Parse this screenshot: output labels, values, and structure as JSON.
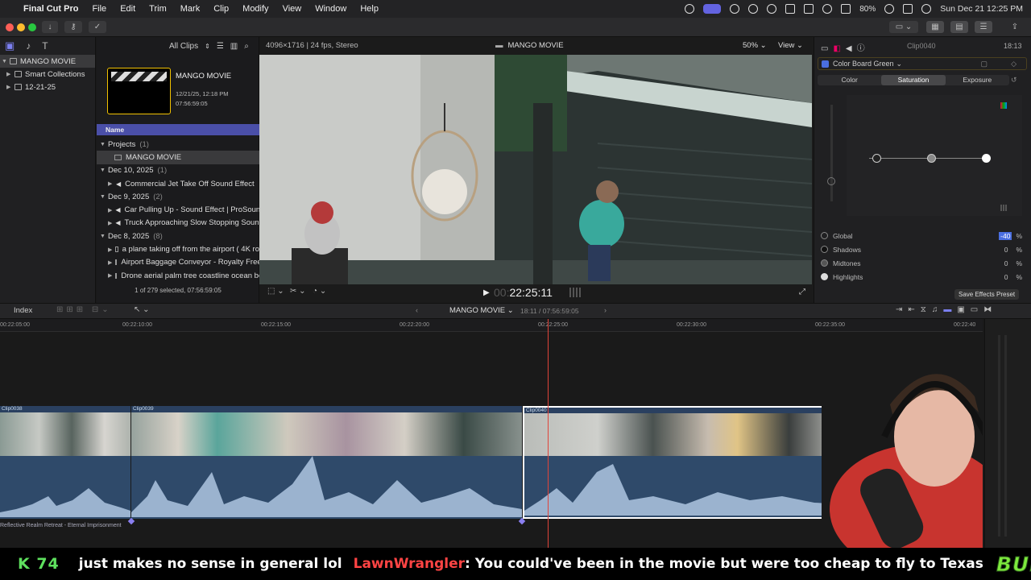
{
  "menubar": {
    "apple": "",
    "app": "Final Cut Pro",
    "items": [
      "File",
      "Edit",
      "Trim",
      "Mark",
      "Clip",
      "Modify",
      "View",
      "Window",
      "Help"
    ],
    "battery": "80%",
    "datetime": "Sun Dec 21  12:25 PM"
  },
  "browser_header": {
    "filter": "All Clips",
    "format": "4096×1716 | 24 fps, Stereo"
  },
  "library": {
    "items": [
      {
        "label": "MANGO MOVIE",
        "selected": true
      },
      {
        "label": "Smart Collections"
      },
      {
        "label": "12-21-25"
      }
    ]
  },
  "project_card": {
    "title": "MANGO MOVIE",
    "date": "12/21/25, 12:18 PM",
    "duration": "07:56:59:05"
  },
  "browser": {
    "column_header": "Name",
    "groups": [
      {
        "label": "Projects",
        "count": "(1)",
        "items": [
          "MANGO MOVIE"
        ]
      },
      {
        "label": "Dec 10, 2025",
        "count": "(1)",
        "items": [
          "Commercial Jet Take Off Sound Effect"
        ]
      },
      {
        "label": "Dec 9, 2025",
        "count": "(2)",
        "items": [
          "Car Pulling Up - Sound Effect  |  ProSound",
          "Truck Approaching Slow Stopping Sound"
        ]
      },
      {
        "label": "Dec 8, 2025",
        "count": "(8)",
        "items": [
          "a plane taking off from the airport ( 4K ro",
          "Airport Baggage Conveyor - Royalty Free",
          "Drone aerial palm tree coastline ocean be"
        ]
      }
    ],
    "status": "1 of 279 selected, 07:56:59:05"
  },
  "viewer": {
    "project_title": "MANGO MOVIE",
    "zoom": "50%",
    "view_menu": "View",
    "timecode_dim": "00:",
    "timecode": "22:25:11"
  },
  "inspector": {
    "clip_name": "Clip0040",
    "duration": "18:13",
    "effect_name": "Color Board Green",
    "tabs": [
      "Color",
      "Saturation",
      "Exposure"
    ],
    "active_tab": "Saturation",
    "params": [
      {
        "label": "Global",
        "value": "-40",
        "unit": "%"
      },
      {
        "label": "Shadows",
        "value": "0",
        "unit": "%"
      },
      {
        "label": "Midtones",
        "value": "0",
        "unit": "%"
      },
      {
        "label": "Highlights",
        "value": "0",
        "unit": "%"
      }
    ],
    "save_button": "Save Effects Preset"
  },
  "timeline": {
    "index_label": "Index",
    "project_menu": "MANGO MOVIE",
    "position": "18:11 / 07:56:59:05",
    "ruler_ticks": [
      "00:22:05:00",
      "00:22:10:00",
      "00:22:15:00",
      "00:22:20:00",
      "00:22:25:00",
      "00:22:30:00",
      "00:22:35:00",
      "00:22:40"
    ],
    "clips": [
      "Clip0038",
      "Clip0039",
      "Clip0040"
    ],
    "audio_clip": "Reflective Realm Retreat - Eternal Imprisonment"
  },
  "ticker": {
    "left_badge": "K 74",
    "message1": "just makes no sense in general lol",
    "user": "LawnWrangler",
    "message2": ": You could've been in the movie but were too cheap to fly to Texas",
    "brand": "BURGER PLANET"
  },
  "colors": {
    "accent": "#6363e0",
    "browser_header": "#4a4fa8",
    "clip_blue": "#3d5a80",
    "playhead": "#e0443a",
    "ticker_green": "#5ee05e",
    "ticker_user": "#ff4444",
    "ticker_brand": "#7de83d"
  }
}
